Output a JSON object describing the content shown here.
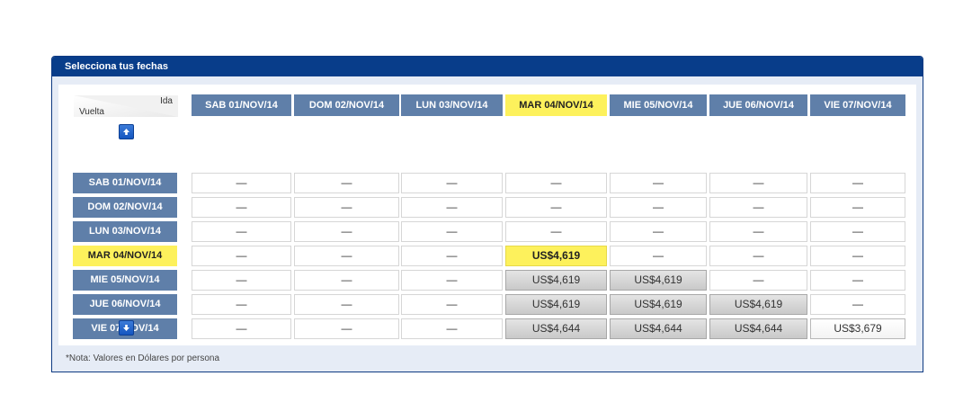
{
  "panel": {
    "title": "Selecciona tus fechas"
  },
  "corner": {
    "ida": "Ida",
    "vuelta": "Vuelta"
  },
  "icons": {
    "up": "arrow-up-icon",
    "down": "arrow-down-icon"
  },
  "colors": {
    "header": "#083d8a",
    "date_button": "#5f7fa9",
    "selected": "#fdf15c"
  },
  "columns": [
    {
      "label": "SAB 01/NOV/14"
    },
    {
      "label": "DOM 02/NOV/14"
    },
    {
      "label": "LUN 03/NOV/14"
    },
    {
      "label": "MAR 04/NOV/14",
      "selected": true
    },
    {
      "label": "MIE 05/NOV/14"
    },
    {
      "label": "JUE 06/NOV/14"
    },
    {
      "label": "VIE 07/NOV/14"
    }
  ],
  "rows": [
    {
      "label": "SAB 01/NOV/14",
      "cells": [
        "—",
        "—",
        "—",
        "—",
        "—",
        "—",
        "—"
      ]
    },
    {
      "label": "DOM 02/NOV/14",
      "cells": [
        "—",
        "—",
        "—",
        "—",
        "—",
        "—",
        "—"
      ]
    },
    {
      "label": "LUN 03/NOV/14",
      "cells": [
        "—",
        "—",
        "—",
        "—",
        "—",
        "—",
        "—"
      ]
    },
    {
      "label": "MAR 04/NOV/14",
      "selected": true,
      "cells": [
        "—",
        "—",
        "—",
        "US$4,619",
        "—",
        "—",
        "—"
      ]
    },
    {
      "label": "MIE 05/NOV/14",
      "cells": [
        "—",
        "—",
        "—",
        "US$4,619",
        "US$4,619",
        "—",
        "—"
      ]
    },
    {
      "label": "JUE 06/NOV/14",
      "cells": [
        "—",
        "—",
        "—",
        "US$4,619",
        "US$4,619",
        "US$4,619",
        "—"
      ]
    },
    {
      "label": "VIE 07/NOV/14",
      "cells": [
        "—",
        "—",
        "—",
        "US$4,644",
        "US$4,644",
        "US$4,644",
        "US$3,679"
      ]
    }
  ],
  "selected_cell": {
    "row": 3,
    "col": 3
  },
  "white_price_cell": {
    "row": 6,
    "col": 6
  },
  "note": "*Nota: Valores en Dólares por persona"
}
